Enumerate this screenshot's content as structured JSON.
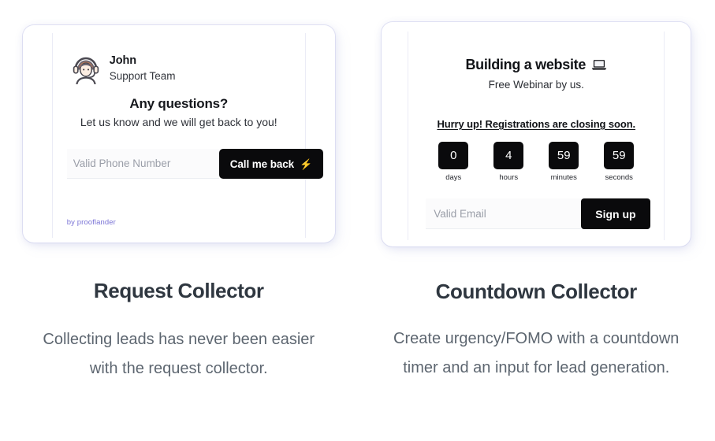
{
  "features": [
    {
      "id": "request-collector",
      "title": "Request Collector",
      "description": "Collecting leads has never been easier with the request collector.",
      "widget": {
        "agent_name": "John",
        "agent_role": "Support Team",
        "heading": "Any questions?",
        "subheading": "Let us know and we will get back to you!",
        "input_placeholder": "Valid Phone Number",
        "input_value": "",
        "button_label": "Call me back",
        "button_icon": "lightning-bolt-icon",
        "brand_credit": "by prooflander",
        "colors": {
          "button_bg": "#0a0a0c",
          "bolt": "#f5c518",
          "brand_credit": "#7b74d6"
        }
      }
    },
    {
      "id": "countdown-collector",
      "title": "Countdown Collector",
      "description": "Create urgency/FOMO with a countdown timer and an input for lead generation.",
      "widget": {
        "title": "Building a website",
        "title_icon": "laptop-icon",
        "subtitle": "Free Webinar by us.",
        "urgency_text": "Hurry up! Registrations are closing soon.",
        "countdown": [
          {
            "value": "0",
            "label": "days"
          },
          {
            "value": "4",
            "label": "hours"
          },
          {
            "value": "59",
            "label": "minutes"
          },
          {
            "value": "59",
            "label": "seconds"
          }
        ],
        "input_placeholder": "Valid Email",
        "input_value": "",
        "button_label": "Sign up",
        "colors": {
          "button_bg": "#0a0a0c",
          "box_bg": "#0a0a0c"
        }
      }
    }
  ]
}
